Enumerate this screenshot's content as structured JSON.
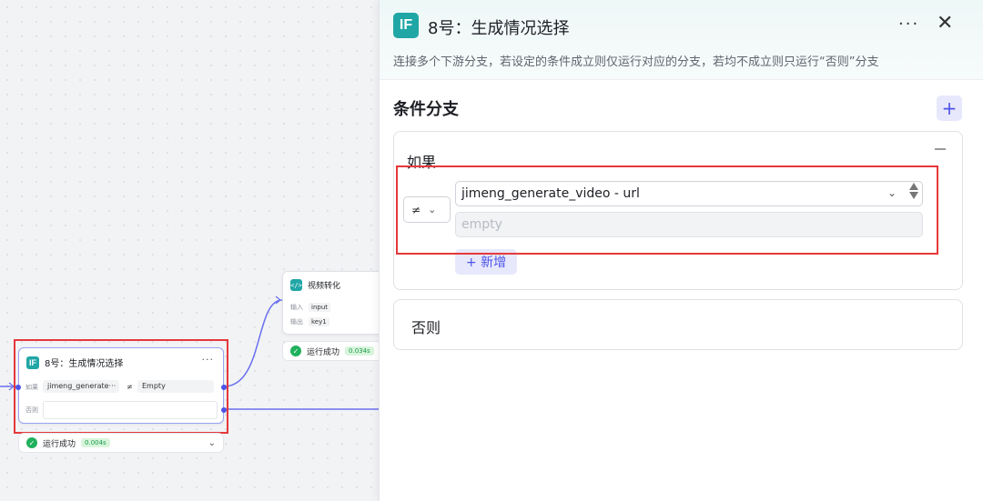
{
  "canvas": {
    "if_node": {
      "badge": "IF",
      "title": "8号：生成情况选择",
      "more": "···",
      "if_label": "如果",
      "else_label": "否则",
      "var": "jimeng_generate···",
      "op_symbol": "≠",
      "value": "Empty",
      "status": "运行成功",
      "time": "0.004s",
      "chevron": "⌄"
    },
    "video_node": {
      "badge": "</>",
      "title": "视频转化",
      "in_label": "输入",
      "in_value": "input",
      "out_label": "输出",
      "out_value": "key1",
      "status": "运行成功",
      "time": "0.034s"
    }
  },
  "panel": {
    "badge": "IF",
    "title": "8号：生成情况选择",
    "more": "···",
    "close": "✕",
    "description": "连接多个下游分支，若设定的条件成立则仅运行对应的分支，若均不成立则只运行“否则”分支",
    "section_title": "条件分支",
    "add": "+",
    "if_label": "如果",
    "operator": "≠",
    "operator_chevron": "⌄",
    "variable": "jimeng_generate_video - url",
    "variable_chevron": "⌄",
    "value_placeholder": "empty",
    "new_button": "+ 新增",
    "else_label": "否则"
  },
  "colors": {
    "accent": "#4d53e8",
    "teal": "#21a6a6",
    "success": "#1fb05c",
    "highlight": "#e5383b"
  }
}
